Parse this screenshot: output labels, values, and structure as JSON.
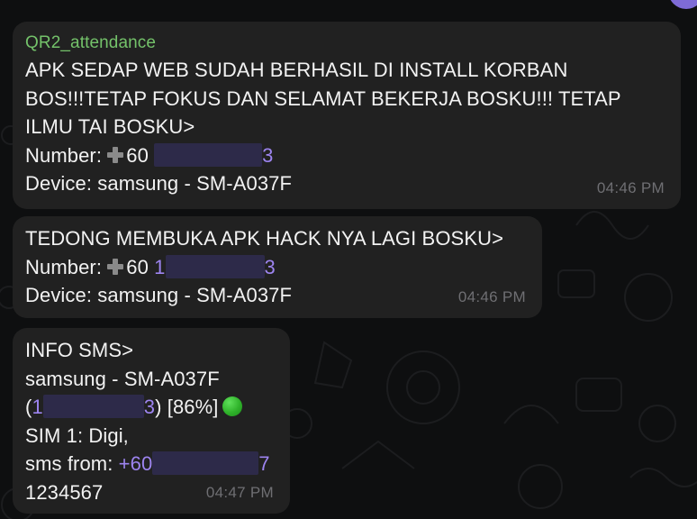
{
  "colors": {
    "background": "#0e0f10",
    "bubble": "#212121",
    "sender_name": "#74c26a",
    "link": "#9d84f0",
    "timestamp": "#6f6f73",
    "redaction": "#2d2a49",
    "status_dot": "#2fb22a"
  },
  "messages": [
    {
      "sender": "QR2_attendance",
      "lines": [
        "APK SEDAP WEB SUDAH BERHASIL DI INSTALL KORBAN",
        "BOS!!!TETAP FOKUS DAN SELAMAT BEKERJA BOSKU!!! TETAP",
        "ILMU TAI BOSKU>"
      ],
      "number_label": "Number: ",
      "number_prefix": "60 ",
      "number_tail": "3",
      "device": "Device: samsung - SM-A037F",
      "time": "04:46 PM"
    },
    {
      "lines": [
        "TEDONG MEMBUKA APK HACK NYA LAGI BOSKU>"
      ],
      "number_label": "Number: ",
      "number_prefix": "60 ",
      "number_link_start": "1",
      "number_tail": "3",
      "device": "Device: samsung - SM-A037F",
      "time": "04:46 PM"
    },
    {
      "header": "INFO SMS>",
      "device": "samsung - SM-A037F",
      "open_paren": " (",
      "number_link_start": "1",
      "number_tail": "3",
      "battery": ") [86%]",
      "sim": "SIM 1: Digi,",
      "sms_from_label": "sms from: ",
      "sms_from_number": "+60",
      "sms_from_tail": "7",
      "body": "1234567",
      "time": "04:47 PM"
    }
  ]
}
